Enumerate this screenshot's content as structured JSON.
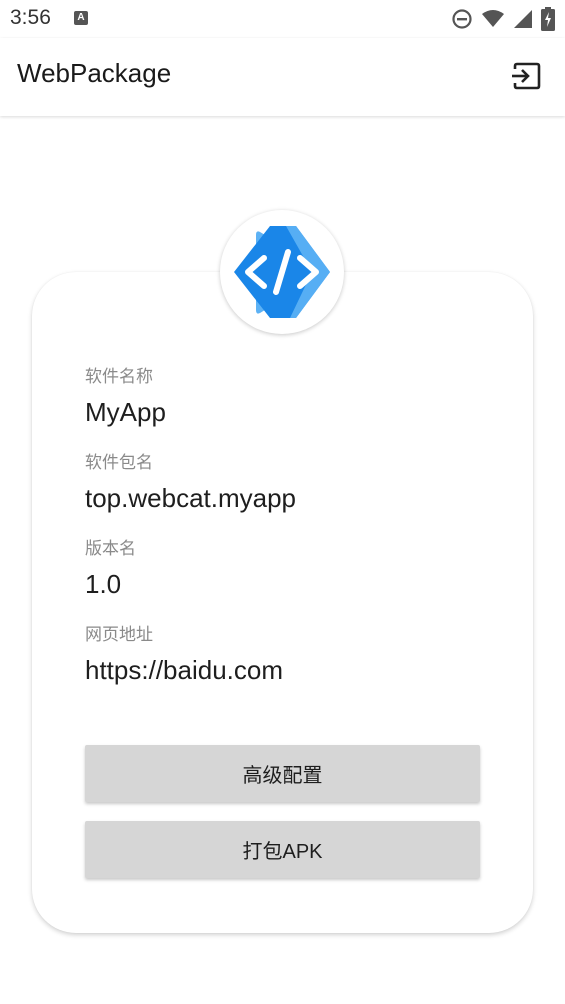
{
  "status_bar": {
    "time": "3:56",
    "notification_icon": "a-letter-icon",
    "icons": [
      "do-not-disturb-icon",
      "wifi-icon",
      "signal-icon",
      "battery-charging-icon"
    ]
  },
  "app_bar": {
    "title": "WebPackage",
    "action_icon": "cast-icon"
  },
  "card": {
    "logo_icon": "code-brackets-logo",
    "fields": [
      {
        "label": "软件名称",
        "value": "MyApp"
      },
      {
        "label": "软件包名",
        "value": "top.webcat.myapp"
      },
      {
        "label": "版本名",
        "value": "1.0"
      },
      {
        "label": "网页地址",
        "value": "https://baidu.com"
      }
    ],
    "buttons": {
      "advanced_label": "高级配置",
      "package_label": "打包APK"
    }
  },
  "colors": {
    "logo_primary": "#1a86e8",
    "logo_light": "#5db2f5",
    "button_bg": "#d6d6d6",
    "label_gray": "#8a8a8a"
  }
}
